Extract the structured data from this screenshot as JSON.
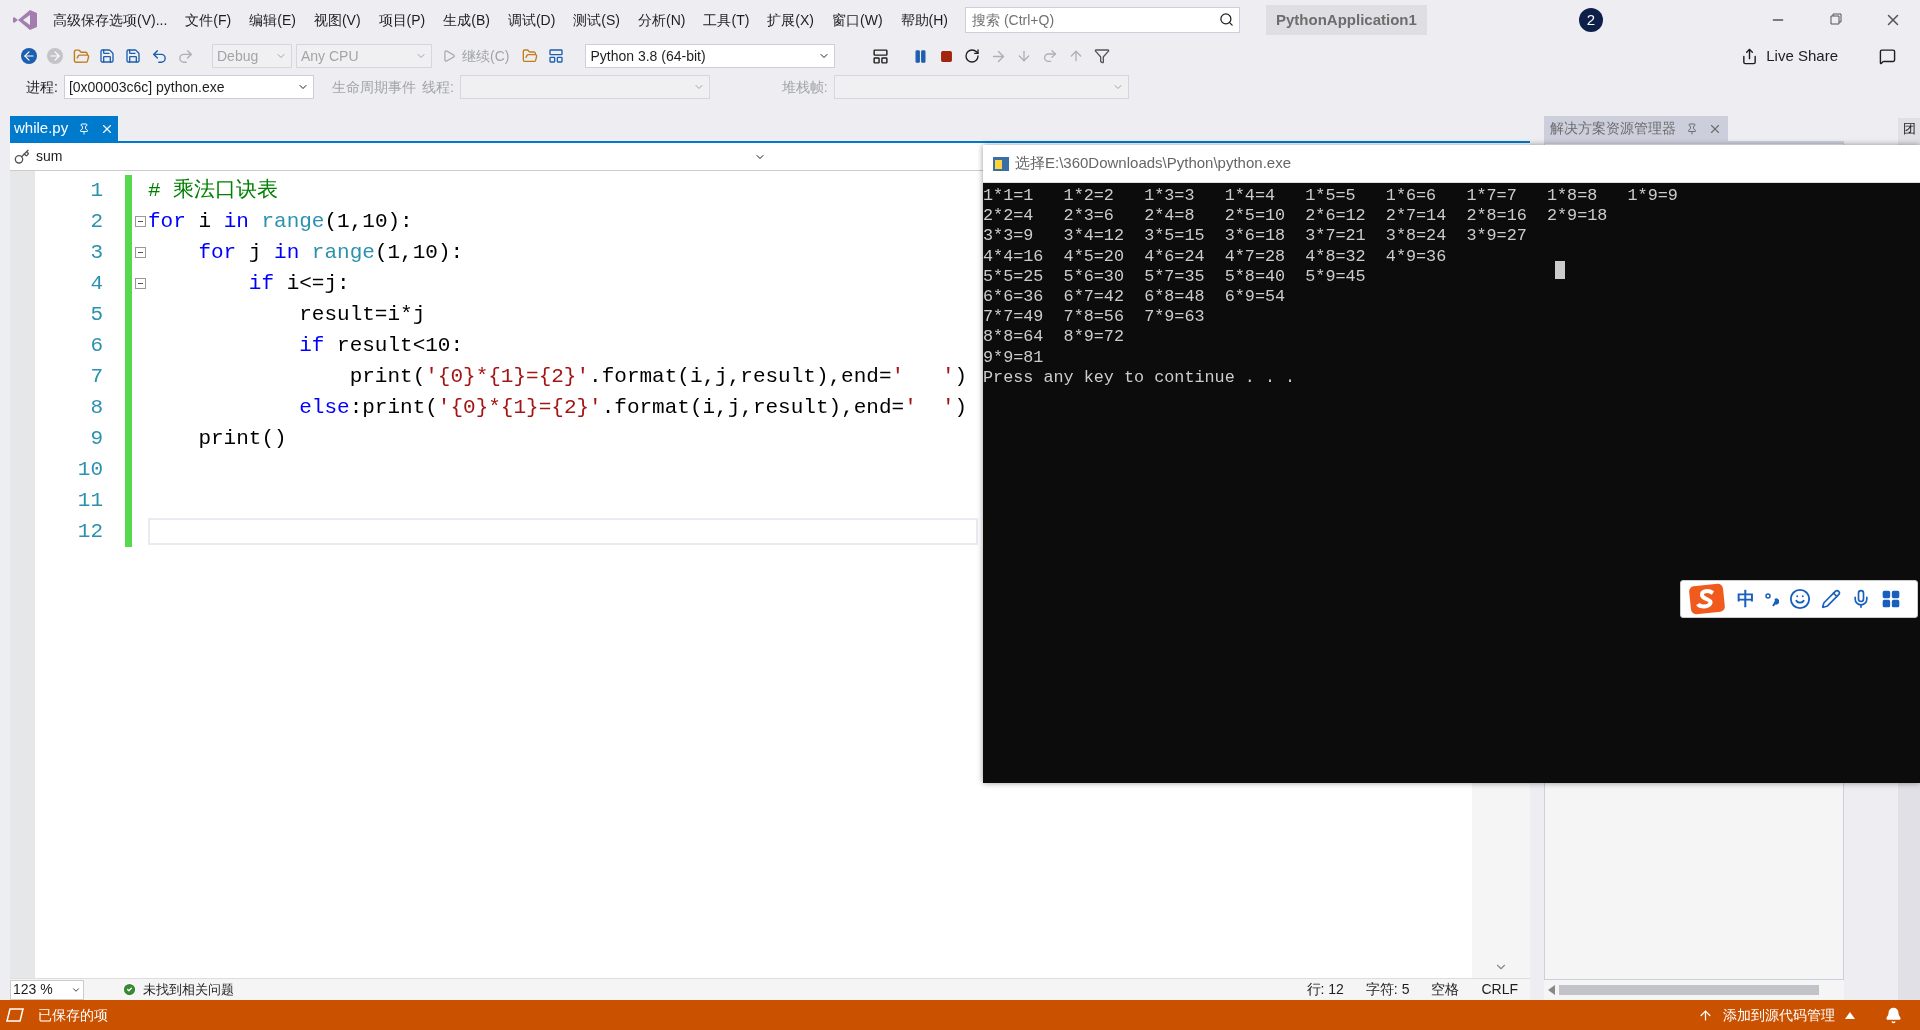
{
  "menu": {
    "items": [
      "高级保存选项(V)...",
      "文件(F)",
      "编辑(E)",
      "视图(V)",
      "项目(P)",
      "生成(B)",
      "调试(D)",
      "测试(S)",
      "分析(N)",
      "工具(T)",
      "扩展(X)",
      "窗口(W)",
      "帮助(H)"
    ],
    "search": {
      "placeholder": "搜索 (Ctrl+Q)"
    },
    "project": "PythonApplication1",
    "notifications": "2"
  },
  "toolbar": {
    "configuration": "Debug",
    "platform": "Any CPU",
    "continue": "继续(C)",
    "environment": "Python 3.8 (64-bit)",
    "live_share": "Live Share"
  },
  "debug_bar": {
    "process_label": "进程:",
    "process": "[0x00003c6c] python.exe",
    "lifecycle": "生命周期事件",
    "thread_label": "线程:",
    "stack_label": "堆栈帧:"
  },
  "tabs": [
    {
      "label": "while.py",
      "selected": true
    }
  ],
  "navigation": {
    "member": "sum"
  },
  "code_lines": [
    {
      "number": "1",
      "foldable": false,
      "current": false,
      "tokens": [
        {
          "kind": "comment",
          "text": "# 乘法口诀表"
        }
      ]
    },
    {
      "number": "2",
      "foldable": true,
      "current": false,
      "tokens": [
        {
          "kind": "keyword",
          "text": "for"
        },
        {
          "kind": "plain",
          "text": " i "
        },
        {
          "kind": "keyword",
          "text": "in"
        },
        {
          "kind": "builtin",
          "text": " range"
        },
        {
          "kind": "plain",
          "text": "(1,10):"
        }
      ]
    },
    {
      "number": "3",
      "foldable": true,
      "current": false,
      "tokens": [
        {
          "kind": "keyword",
          "text": "    for"
        },
        {
          "kind": "plain",
          "text": " j "
        },
        {
          "kind": "keyword",
          "text": "in"
        },
        {
          "kind": "builtin",
          "text": " range"
        },
        {
          "kind": "plain",
          "text": "(1,10):"
        }
      ]
    },
    {
      "number": "4",
      "foldable": true,
      "current": false,
      "tokens": [
        {
          "kind": "keyword",
          "text": "        if"
        },
        {
          "kind": "plain",
          "text": " i<=j:"
        }
      ]
    },
    {
      "number": "5",
      "foldable": false,
      "current": false,
      "tokens": [
        {
          "kind": "plain",
          "text": "            result=i*j"
        }
      ]
    },
    {
      "number": "6",
      "foldable": false,
      "current": false,
      "tokens": [
        {
          "kind": "keyword",
          "text": "            if"
        },
        {
          "kind": "plain",
          "text": " result<10:"
        }
      ]
    },
    {
      "number": "7",
      "foldable": false,
      "current": false,
      "tokens": [
        {
          "kind": "plain",
          "text": "                print("
        },
        {
          "kind": "string",
          "text": "'{0}*{1}={2}'"
        },
        {
          "kind": "plain",
          "text": ".format(i,j,result),end="
        },
        {
          "kind": "string",
          "text": "'   '"
        },
        {
          "kind": "plain",
          "text": ")"
        }
      ]
    },
    {
      "number": "8",
      "foldable": false,
      "current": false,
      "tokens": [
        {
          "kind": "keyword",
          "text": "            else"
        },
        {
          "kind": "plain",
          "text": ":print("
        },
        {
          "kind": "string",
          "text": "'{0}*{1}={2}'"
        },
        {
          "kind": "plain",
          "text": ".format(i,j,result),end="
        },
        {
          "kind": "string",
          "text": "'  '"
        },
        {
          "kind": "plain",
          "text": ")"
        }
      ]
    },
    {
      "number": "9",
      "foldable": false,
      "current": false,
      "tokens": [
        {
          "kind": "plain",
          "text": "    print()"
        }
      ]
    },
    {
      "number": "10",
      "foldable": false,
      "current": false
    },
    {
      "number": "11",
      "foldable": false,
      "current": false
    },
    {
      "number": "12",
      "foldable": false,
      "current": true
    }
  ],
  "console": {
    "title": "选择E:\\360Downloads\\Python\\python.exe",
    "lines": [
      "1*1=1   1*2=2   1*3=3   1*4=4   1*5=5   1*6=6   1*7=7   1*8=8   1*9=9",
      "2*2=4   2*3=6   2*4=8   2*5=10  2*6=12  2*7=14  2*8=16  2*9=18",
      "3*3=9   3*4=12  3*5=15  3*6=18  3*7=21  3*8=24  3*9=27",
      "4*4=16  4*5=20  4*6=24  4*7=28  4*8=32  4*9=36",
      "5*5=25  5*6=30  5*7=35  5*8=40  5*9=45",
      "6*6=36  6*7=42  6*8=48  6*9=54",
      "7*7=49  7*8=56  7*9=63",
      "8*8=64  8*9=72",
      "9*9=81",
      "Press any key to continue . . ."
    ]
  },
  "ime": {
    "mode": "中"
  },
  "solution_explorer": {
    "title": "解决方案资源管理器"
  },
  "side_tab": "团",
  "editor_status": {
    "zoom": "123 %",
    "issues": "未找到相关问题",
    "line": "行: 12",
    "char": "字符: 5",
    "spaces": "空格",
    "eol": "CRLF"
  },
  "status_bar": {
    "message": "已保存的项",
    "source_control": "添加到源代码管理"
  }
}
